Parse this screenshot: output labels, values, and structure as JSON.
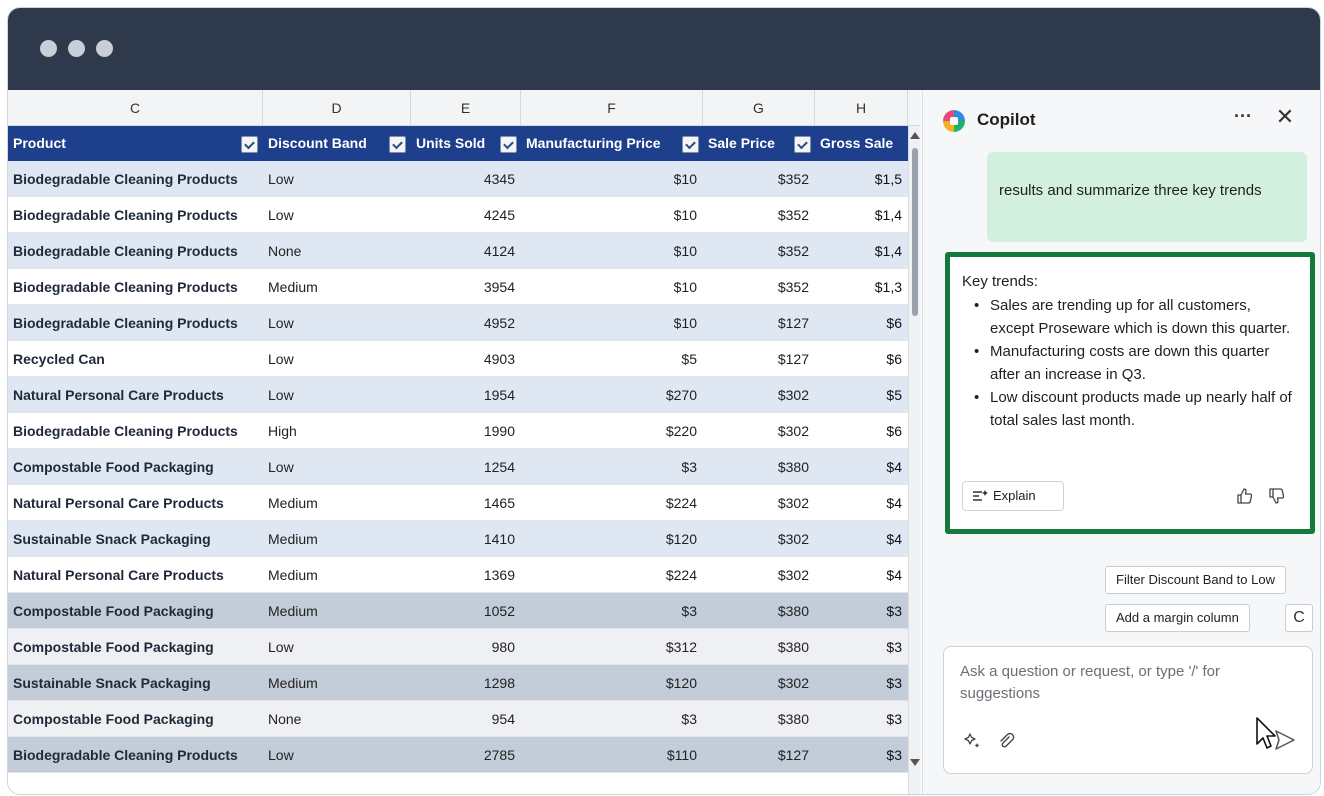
{
  "window": {
    "controls": [
      "close-dot",
      "minimize-dot",
      "maximize-dot"
    ],
    "titlebar_color": "#2e3a4b"
  },
  "sheet": {
    "column_letters": [
      "C",
      "D",
      "E",
      "F",
      "G",
      "H"
    ],
    "headers": [
      "Product",
      "Discount Band",
      "Units Sold",
      "Manufacturing Price",
      "Sale Price",
      "Gross Sale"
    ],
    "header_color": "#1d3f8c",
    "rows": [
      [
        "Biodegradable Cleaning Products",
        "Low",
        "4345",
        "$10",
        "$352",
        "$1,5"
      ],
      [
        "Biodegradable Cleaning Products",
        "Low",
        "4245",
        "$10",
        "$352",
        "$1,4"
      ],
      [
        "Biodegradable Cleaning Products",
        "None",
        "4124",
        "$10",
        "$352",
        "$1,4"
      ],
      [
        "Biodegradable Cleaning Products",
        "Medium",
        "3954",
        "$10",
        "$352",
        "$1,3"
      ],
      [
        "Biodegradable Cleaning Products",
        "Low",
        "4952",
        "$10",
        "$127",
        "$6"
      ],
      [
        "Recycled Can",
        "Low",
        "4903",
        "$5",
        "$127",
        "$6"
      ],
      [
        "Natural Personal Care Products",
        "Low",
        "1954",
        "$270",
        "$302",
        "$5"
      ],
      [
        "Biodegradable Cleaning Products",
        "High",
        "1990",
        "$220",
        "$302",
        "$6"
      ],
      [
        "Compostable Food Packaging",
        "Low",
        "1254",
        "$3",
        "$380",
        "$4"
      ],
      [
        "Natural Personal Care Products",
        "Medium",
        "1465",
        "$224",
        "$302",
        "$4"
      ],
      [
        "Sustainable Snack Packaging",
        "Medium",
        "1410",
        "$120",
        "$302",
        "$4"
      ],
      [
        "Natural Personal Care Products",
        "Medium",
        "1369",
        "$224",
        "$302",
        "$4"
      ],
      [
        "Compostable Food Packaging",
        "Medium",
        "1052",
        "$3",
        "$380",
        "$3"
      ],
      [
        "Compostable Food Packaging",
        "Low",
        "980",
        "$312",
        "$380",
        "$3"
      ],
      [
        "Sustainable Snack Packaging",
        "Medium",
        "1298",
        "$120",
        "$302",
        "$3"
      ],
      [
        "Compostable Food Packaging",
        "None",
        "954",
        "$3",
        "$380",
        "$3"
      ],
      [
        "Biodegradable Cleaning Products",
        "Low",
        "2785",
        "$110",
        "$127",
        "$3"
      ]
    ],
    "row_bands": [
      "band-b",
      "band-a",
      "band-b",
      "band-a",
      "band-b",
      "band-a",
      "band-b",
      "band-a",
      "band-b",
      "band-a",
      "band-b",
      "band-a",
      "band-c",
      "band-d",
      "band-c",
      "band-d",
      "band-c"
    ]
  },
  "copilot": {
    "title": "Copilot",
    "more_label": "···",
    "close_label": "✕",
    "user_message": "results and summarize three key trends",
    "answer": {
      "heading": "Key trends:",
      "bullets": [
        "Sales are trending up for all customers, except Proseware which is down this quarter.",
        "Manufacturing costs are down this quarter after an increase in Q3.",
        "Low discount products made up nearly half of total sales last month."
      ],
      "explain_label": "Explain",
      "border_color": "#137a3b"
    },
    "suggestions": [
      "Filter Discount Band to Low",
      "Add a margin column"
    ],
    "refresh_label": "C",
    "composer_placeholder": "Ask a question or request, or type '/' for suggestions"
  }
}
